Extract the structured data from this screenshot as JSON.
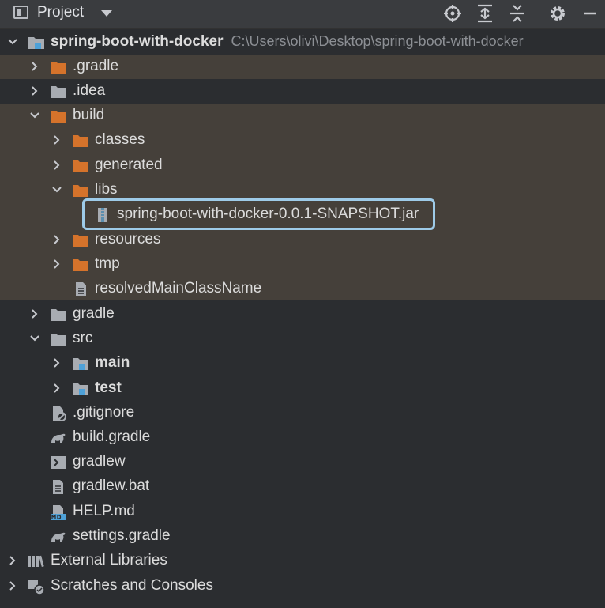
{
  "header": {
    "title": "Project"
  },
  "tree": {
    "root": {
      "name": "spring-boot-with-docker",
      "path": "C:\\Users\\olivi\\Desktop\\spring-boot-with-docker"
    },
    "gradle_hidden": ".gradle",
    "idea": ".idea",
    "build": "build",
    "classes": "classes",
    "generated": "generated",
    "libs": "libs",
    "jar": "spring-boot-with-docker-0.0.1-SNAPSHOT.jar",
    "resources": "resources",
    "tmp": "tmp",
    "resolved": "resolvedMainClassName",
    "gradle": "gradle",
    "src": "src",
    "main": "main",
    "test": "test",
    "gitignore": ".gitignore",
    "build_gradle": "build.gradle",
    "gradlew": "gradlew",
    "gradlew_bat": "gradlew.bat",
    "help_md": "HELP.md",
    "settings_gradle": "settings.gradle",
    "external_libraries": "External Libraries",
    "scratches": "Scratches and Consoles"
  },
  "colors": {
    "folder_excluded": "#d5732b",
    "folder_normal": "#a8acb2",
    "module_marker": "#4ea1d8",
    "highlight": "#9ecbe8",
    "excluded_band": "#45403a"
  }
}
